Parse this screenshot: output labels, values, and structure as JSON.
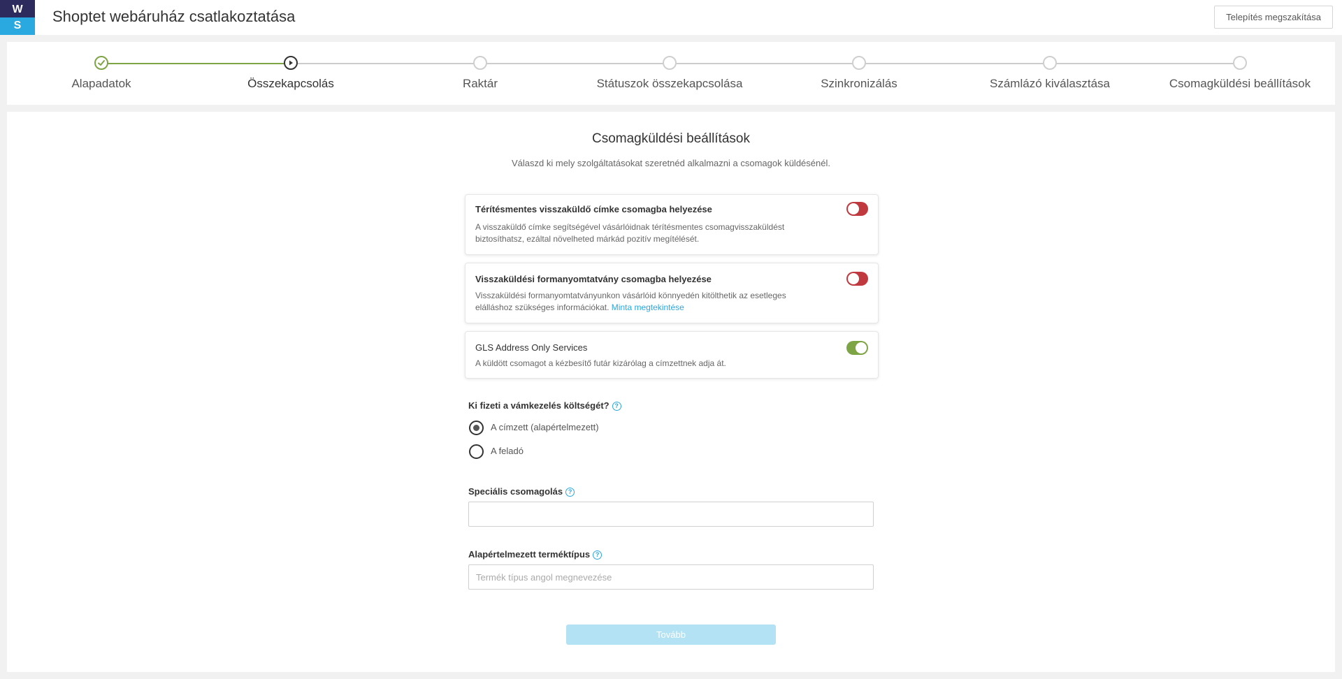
{
  "header": {
    "logo_top": "W",
    "logo_bottom": "S",
    "title": "Shoptet webáruház csatlakoztatása",
    "cancel_label": "Telepítés megszakítása"
  },
  "stepper": {
    "steps": [
      {
        "label": "Alapadatok",
        "state": "done"
      },
      {
        "label": "Összekapcsolás",
        "state": "current"
      },
      {
        "label": "Raktár",
        "state": "pending"
      },
      {
        "label": "Státuszok összekapcsolása",
        "state": "pending"
      },
      {
        "label": "Szinkronizálás",
        "state": "pending"
      },
      {
        "label": "Számlázó kiválasztása",
        "state": "pending"
      },
      {
        "label": "Csomagküldési beállítások",
        "state": "pending"
      }
    ]
  },
  "main": {
    "title": "Csomagküldési beállítások",
    "subtitle": "Válaszd ki mely szolgáltatásokat szeretnéd alkalmazni a csomagok küldésénél.",
    "options": [
      {
        "title": "Térítésmentes visszaküldő címke csomagba helyezése",
        "desc": "A visszaküldő címke segítségével vásárlóidnak térítésmentes csomagvisszaküldést biztosíthatsz, ezáltal növelheted márkád pozitív megítélését.",
        "enabled": false
      },
      {
        "title": "Visszaküldési formanyomtatvány csomagba helyezése",
        "desc": "Visszaküldési formanyomtatványunkon vásárlóid könnyedén kitölthetik az esetleges elálláshoz szükséges információkat.",
        "link": "Minta megtekintése",
        "enabled": false
      },
      {
        "title": "GLS Address Only Services",
        "desc": "A küldött csomagot a kézbesítő futár kizárólag a címzettnek adja át.",
        "enabled": true
      }
    ],
    "customs": {
      "question": "Ki fizeti a vámkezelés költségét?",
      "options": [
        {
          "label": "A címzett (alapértelmezett)",
          "checked": true
        },
        {
          "label": "A feladó",
          "checked": false
        }
      ]
    },
    "special_packaging": {
      "label": "Speciális csomagolás",
      "value": "",
      "placeholder": ""
    },
    "default_product_type": {
      "label": "Alapértelmezett terméktípus",
      "value": "",
      "placeholder": "Termék típus angol megnevezése"
    },
    "next_label": "Tovább"
  },
  "colors": {
    "accent": "#2aa8e0",
    "done": "#7ea545",
    "toggle_off": "#c0393f",
    "logo_dark": "#2d2a5e"
  },
  "icons": {
    "help": "question-circle-icon",
    "step_done": "check-circle-icon",
    "step_current": "play-circle-icon"
  }
}
